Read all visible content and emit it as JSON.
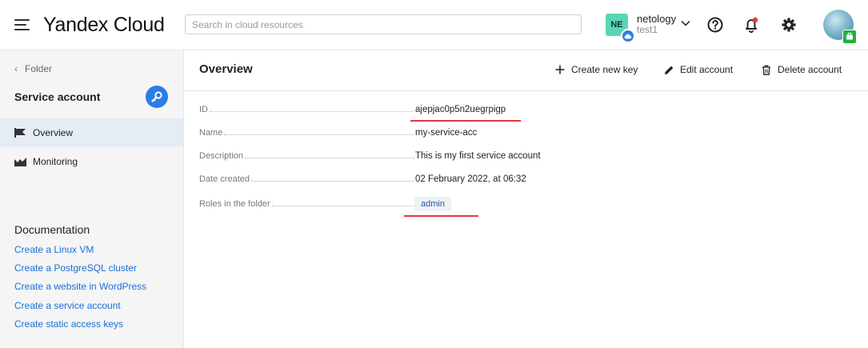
{
  "header": {
    "logo": "Yandex Cloud",
    "search_placeholder": "Search in cloud resources",
    "cloud": {
      "badge": "NE",
      "name": "netology",
      "sub": "test1"
    },
    "icons": [
      "menu-icon",
      "chevron-down-icon",
      "help-icon",
      "bell-icon",
      "gear-icon"
    ],
    "colors": {
      "cloud_badge": "#5ad6b7",
      "accent": "#2a7ee6",
      "notification_dot": "#e0383e",
      "avatar_badge": "#1fb141"
    }
  },
  "sidebar": {
    "back_label": "Folder",
    "title": "Service account",
    "nav": [
      {
        "label": "Overview",
        "active": true,
        "icon": "flag-icon"
      },
      {
        "label": "Monitoring",
        "active": false,
        "icon": "chart-icon"
      }
    ],
    "docs_title": "Documentation",
    "docs": [
      "Create a Linux VM",
      "Create a PostgreSQL cluster",
      "Create a website in WordPress",
      "Create a service account",
      "Create static access keys"
    ]
  },
  "main": {
    "title": "Overview",
    "actions": {
      "create_key": "Create new key",
      "edit": "Edit account",
      "delete": "Delete account"
    },
    "details": [
      {
        "label": "ID",
        "value": "ajepjac0p5n2uegrpigp"
      },
      {
        "label": "Name",
        "value": "my-service-acc"
      },
      {
        "label": "Description",
        "value": "This is my first service account"
      },
      {
        "label": "Date created",
        "value": "02 February 2022, at 06:32"
      }
    ],
    "roles": {
      "label": "Roles in the folder",
      "value": "admin"
    }
  }
}
